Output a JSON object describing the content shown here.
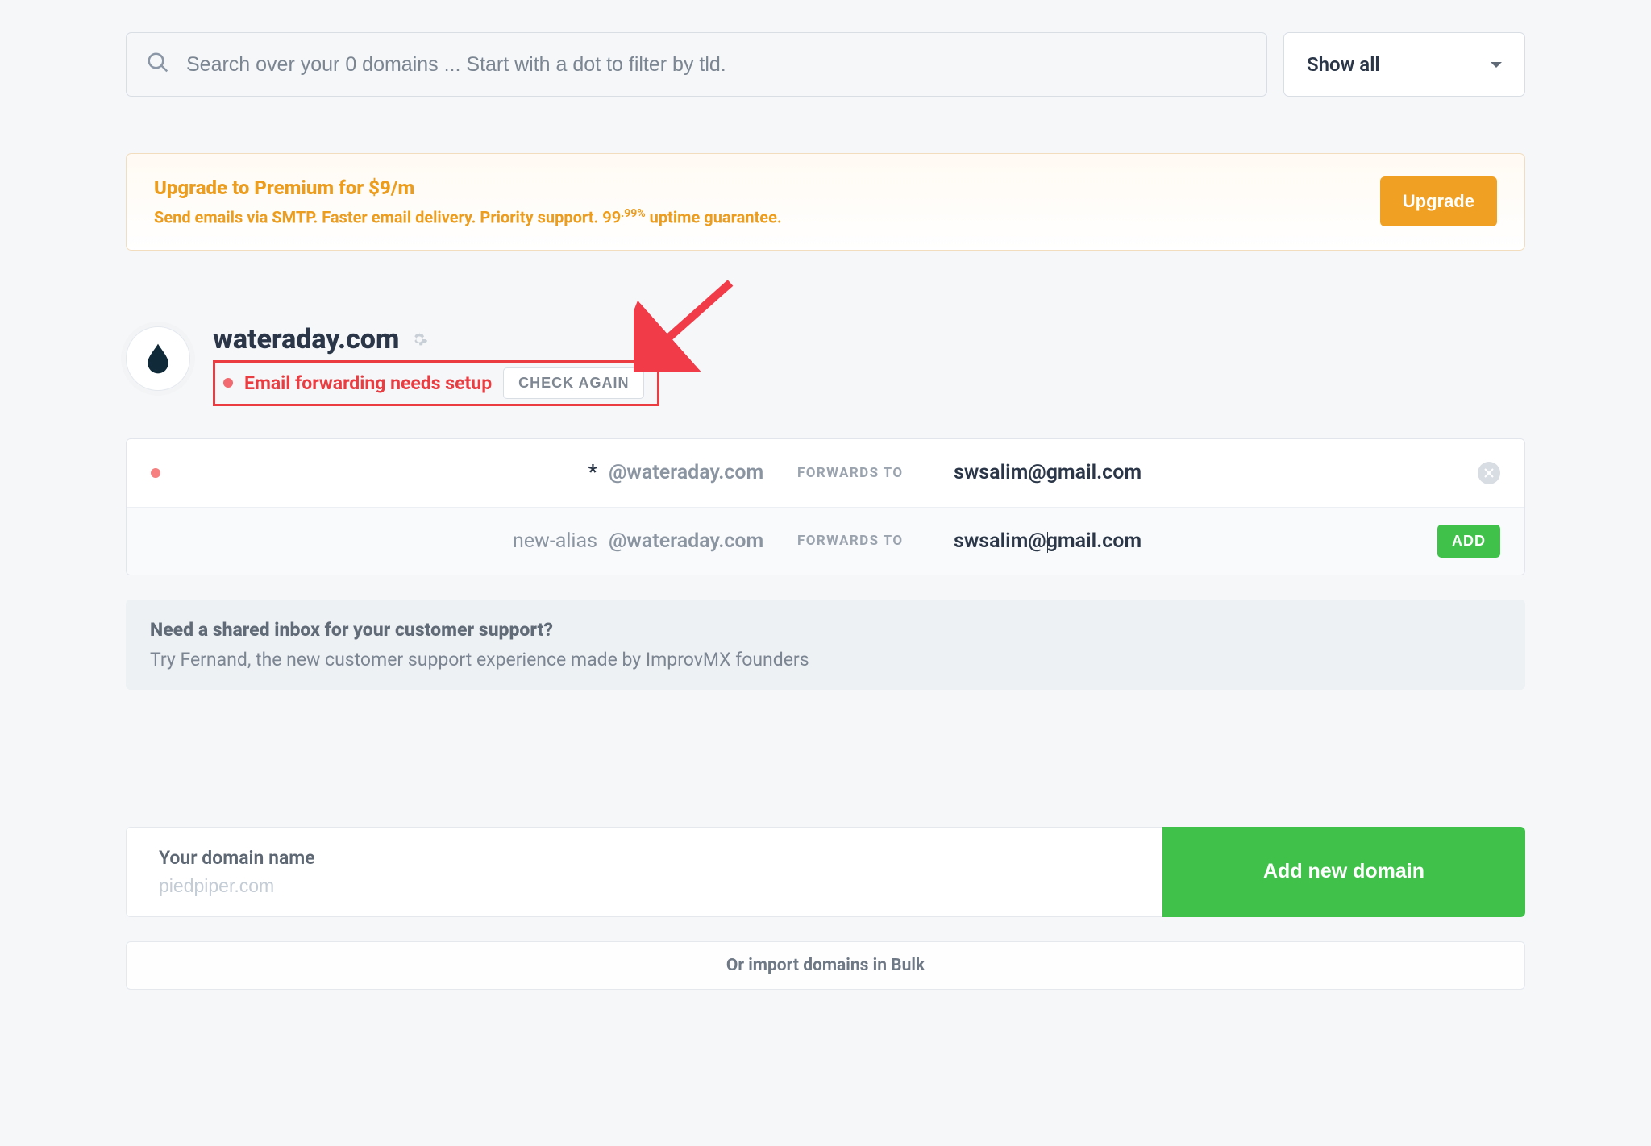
{
  "search": {
    "placeholder": "Search over your 0 domains ... Start with a dot to filter by tld."
  },
  "filter": {
    "selected": "Show all"
  },
  "upgrade_banner": {
    "title": "Upgrade to Premium for $9/m",
    "subtitle_prefix": "Send emails via SMTP. Faster email delivery. Priority support. 99",
    "subtitle_sup": ".99%",
    "subtitle_suffix": " uptime guarantee.",
    "button": "Upgrade"
  },
  "domain": {
    "name": "wateraday.com",
    "status_text": "Email forwarding needs setup",
    "check_again_label": "CHECK AGAIN",
    "at_suffix": "@wateraday.com",
    "forwards_label": "FORWARDS TO",
    "rows": [
      {
        "alias": "*",
        "target": "swsalim@gmail.com"
      },
      {
        "alias": "new-alias",
        "target": "swsalim@gmail.com"
      }
    ],
    "add_label": "ADD"
  },
  "promo": {
    "question": "Need a shared inbox for your customer support?",
    "answer": "Try Fernand, the new customer support experience made by ImprovMX founders"
  },
  "add_domain": {
    "label": "Your domain name",
    "placeholder": "piedpiper.com",
    "button": "Add new domain"
  },
  "bulk_import": "Or import domains in Bulk"
}
